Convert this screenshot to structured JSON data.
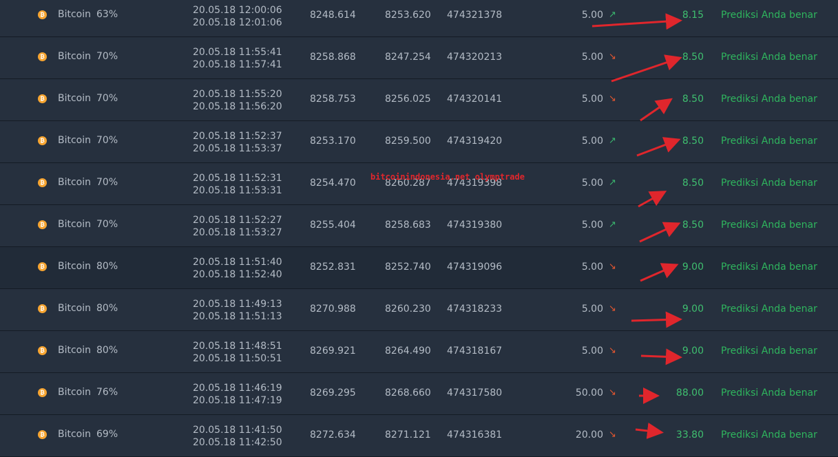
{
  "watermark": "bitcoinindonesia.net olymptrade",
  "rows": [
    {
      "asset": "Bitcoin",
      "pct": "63%",
      "open_time": "20.05.18 12:00:06",
      "close_time": "20.05.18 12:01:06",
      "open_price": "8248.614",
      "close_price": "8253.620",
      "id": "474321378",
      "amount": "5.00",
      "direction": "up",
      "payout": "8.15",
      "result": "Prediksi Anda benar"
    },
    {
      "asset": "Bitcoin",
      "pct": "70%",
      "open_time": "20.05.18 11:55:41",
      "close_time": "20.05.18 11:57:41",
      "open_price": "8258.868",
      "close_price": "8247.254",
      "id": "474320213",
      "amount": "5.00",
      "direction": "down",
      "payout": "8.50",
      "result": "Prediksi Anda benar"
    },
    {
      "asset": "Bitcoin",
      "pct": "70%",
      "open_time": "20.05.18 11:55:20",
      "close_time": "20.05.18 11:56:20",
      "open_price": "8258.753",
      "close_price": "8256.025",
      "id": "474320141",
      "amount": "5.00",
      "direction": "down",
      "payout": "8.50",
      "result": "Prediksi Anda benar"
    },
    {
      "asset": "Bitcoin",
      "pct": "70%",
      "open_time": "20.05.18 11:52:37",
      "close_time": "20.05.18 11:53:37",
      "open_price": "8253.170",
      "close_price": "8259.500",
      "id": "474319420",
      "amount": "5.00",
      "direction": "up",
      "payout": "8.50",
      "result": "Prediksi Anda benar"
    },
    {
      "asset": "Bitcoin",
      "pct": "70%",
      "open_time": "20.05.18 11:52:31",
      "close_time": "20.05.18 11:53:31",
      "open_price": "8254.470",
      "close_price": "8260.287",
      "id": "474319398",
      "amount": "5.00",
      "direction": "up",
      "payout": "8.50",
      "result": "Prediksi Anda benar"
    },
    {
      "asset": "Bitcoin",
      "pct": "70%",
      "open_time": "20.05.18 11:52:27",
      "close_time": "20.05.18 11:53:27",
      "open_price": "8255.404",
      "close_price": "8258.683",
      "id": "474319380",
      "amount": "5.00",
      "direction": "up",
      "payout": "8.50",
      "result": "Prediksi Anda benar"
    },
    {
      "asset": "Bitcoin",
      "pct": "80%",
      "open_time": "20.05.18 11:51:40",
      "close_time": "20.05.18 11:52:40",
      "open_price": "8252.831",
      "close_price": "8252.740",
      "id": "474319096",
      "amount": "5.00",
      "direction": "down",
      "payout": "9.00",
      "result": "Prediksi Anda benar",
      "alt": true
    },
    {
      "asset": "Bitcoin",
      "pct": "80%",
      "open_time": "20.05.18 11:49:13",
      "close_time": "20.05.18 11:51:13",
      "open_price": "8270.988",
      "close_price": "8260.230",
      "id": "474318233",
      "amount": "5.00",
      "direction": "down",
      "payout": "9.00",
      "result": "Prediksi Anda benar"
    },
    {
      "asset": "Bitcoin",
      "pct": "80%",
      "open_time": "20.05.18 11:48:51",
      "close_time": "20.05.18 11:50:51",
      "open_price": "8269.921",
      "close_price": "8264.490",
      "id": "474318167",
      "amount": "5.00",
      "direction": "down",
      "payout": "9.00",
      "result": "Prediksi Anda benar"
    },
    {
      "asset": "Bitcoin",
      "pct": "76%",
      "open_time": "20.05.18 11:46:19",
      "close_time": "20.05.18 11:47:19",
      "open_price": "8269.295",
      "close_price": "8268.660",
      "id": "474317580",
      "amount": "50.00",
      "direction": "down",
      "payout": "88.00",
      "result": "Prediksi Anda benar"
    },
    {
      "asset": "Bitcoin",
      "pct": "69%",
      "open_time": "20.05.18 11:41:50",
      "close_time": "20.05.18 11:42:50",
      "open_price": "8272.634",
      "close_price": "8271.121",
      "id": "474316381",
      "amount": "20.00",
      "direction": "down",
      "payout": "33.80",
      "result": "Prediksi Anda benar"
    }
  ],
  "icons": {
    "coin": "bitcoin-coin-icon",
    "up": "arrow-up-right-icon",
    "down": "arrow-down-right-icon"
  },
  "colors": {
    "background": "#252f3d",
    "positive": "#2fb65e",
    "up_arrow": "#3ab86e",
    "down_arrow": "#e8572f",
    "annotation": "#e0262c",
    "coin": "#f7a531"
  }
}
